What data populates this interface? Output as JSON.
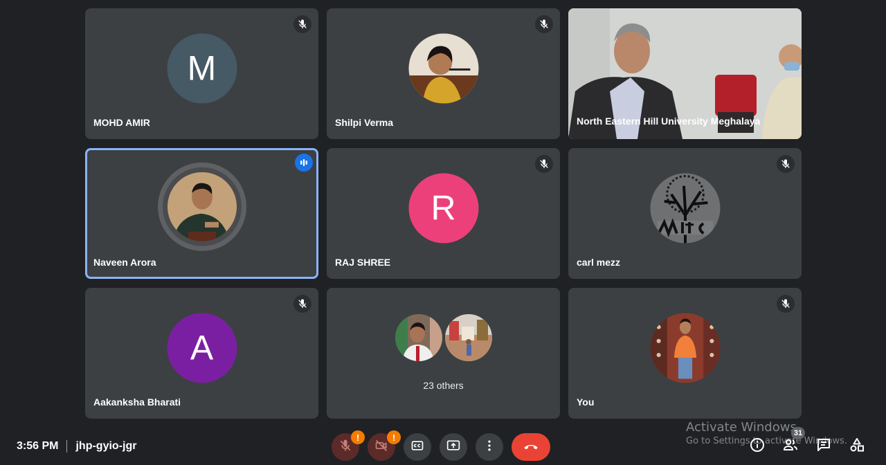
{
  "participants": [
    {
      "name": "MOHD AMIR",
      "initial": "M",
      "color": "#455a64",
      "muted": true
    },
    {
      "name": "Shilpi Verma",
      "muted": true
    },
    {
      "name": "North Eastern Hill University Meghalaya",
      "video": true
    },
    {
      "name": "Naveen Arora",
      "speaking": true
    },
    {
      "name": "RAJ SHREE",
      "initial": "R",
      "color": "#ec407a",
      "muted": true
    },
    {
      "name": "carl mezz",
      "muted": true
    },
    {
      "name": "Aakanksha Bharati",
      "initial": "A",
      "color": "#7b1fa2",
      "muted": true
    },
    {
      "others_label": "23 others"
    },
    {
      "name": "You",
      "muted": true
    }
  ],
  "meeting": {
    "time": "3:56 PM",
    "code": "jhp-gyio-jgr"
  },
  "controls": {
    "mic_warning": "!",
    "camera_warning": "!",
    "participant_count": "31"
  },
  "watermark": {
    "line1": "Activate Windows",
    "line2": "Go to Settings to activate Windows."
  },
  "colors": {
    "background": "#202124",
    "tile": "#3c4043",
    "end_call": "#ea4335",
    "accent": "#8ab4f8"
  }
}
